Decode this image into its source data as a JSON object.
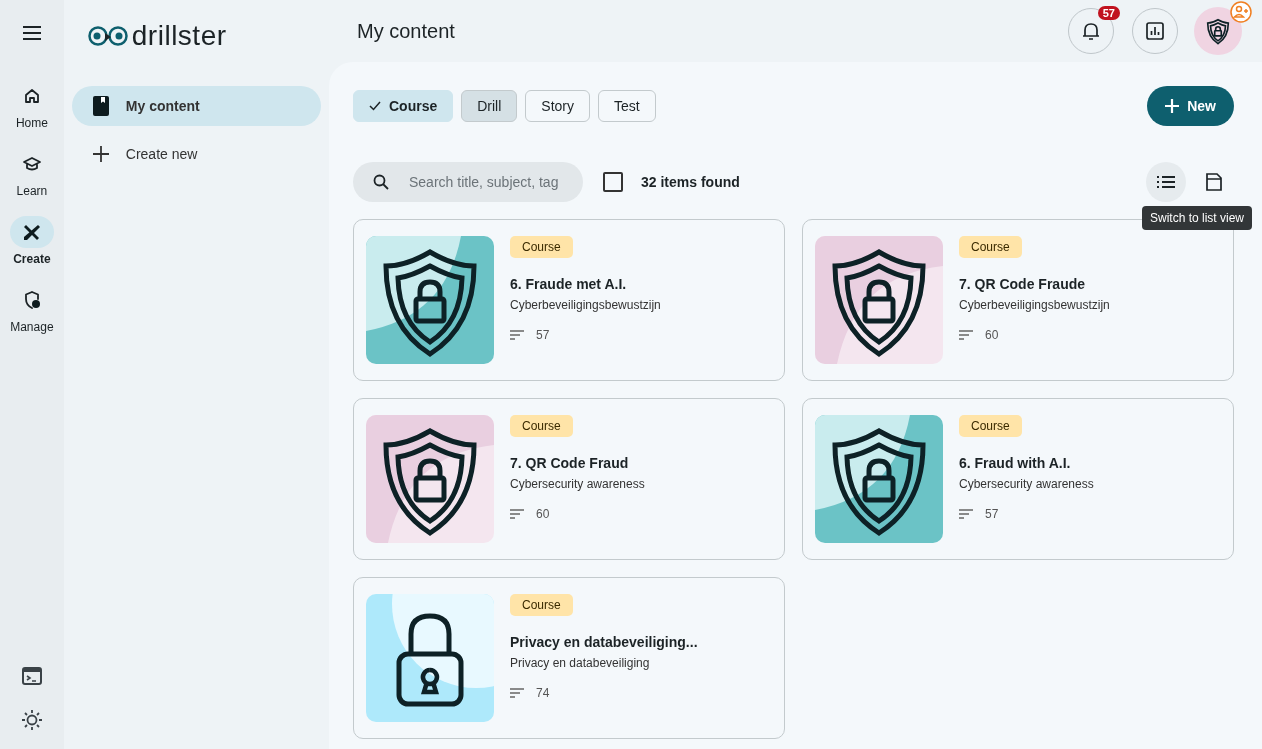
{
  "brand": {
    "name": "drillster"
  },
  "rail": {
    "items": [
      {
        "label": "Home",
        "selected": false
      },
      {
        "label": "Learn",
        "selected": false
      },
      {
        "label": "Create",
        "selected": true
      },
      {
        "label": "Manage",
        "selected": false
      }
    ]
  },
  "sidebar": {
    "items": [
      {
        "label": "My content",
        "selected": true
      },
      {
        "label": "Create new",
        "selected": false
      }
    ]
  },
  "header": {
    "title": "My content",
    "notifications": "57"
  },
  "filters": [
    {
      "label": "Course",
      "selected": true,
      "hovered": false
    },
    {
      "label": "Drill",
      "selected": false,
      "hovered": true
    },
    {
      "label": "Story",
      "selected": false,
      "hovered": false
    },
    {
      "label": "Test",
      "selected": false,
      "hovered": false
    }
  ],
  "new_button": "New",
  "search": {
    "placeholder": "Search title, subject, tag"
  },
  "select_all": {
    "checked": false
  },
  "result_count": "32 items found",
  "view_buttons": [
    {
      "kind": "list",
      "hovered": true
    },
    {
      "kind": "grid",
      "hovered": false
    }
  ],
  "tooltip": "Switch to list view",
  "cards": [
    {
      "badge": "Course",
      "title": "6. Fraude met A.I.",
      "subtitle": "Cyberbeveiligingsbewustzijn",
      "count": "57",
      "kind": "shield",
      "color": "#6bc3c6"
    },
    {
      "badge": "Course",
      "title": "7. QR Code Fraude",
      "subtitle": "Cyberbeveiligingsbewustzijn",
      "count": "60",
      "kind": "shield",
      "color": "#e9cfe0"
    },
    {
      "badge": "Course",
      "title": "7. QR Code Fraud",
      "subtitle": "Cybersecurity awareness",
      "count": "60",
      "kind": "shield",
      "color": "#e9cfe0"
    },
    {
      "badge": "Course",
      "title": "6. Fraud with A.I.",
      "subtitle": "Cybersecurity awareness",
      "count": "57",
      "kind": "shield",
      "color": "#6bc3c6"
    },
    {
      "badge": "Course",
      "title": "Privacy en databeveiliging...",
      "subtitle": "Privacy en databeveiliging",
      "count": "74",
      "kind": "lock",
      "color": "#aee9fb"
    }
  ]
}
